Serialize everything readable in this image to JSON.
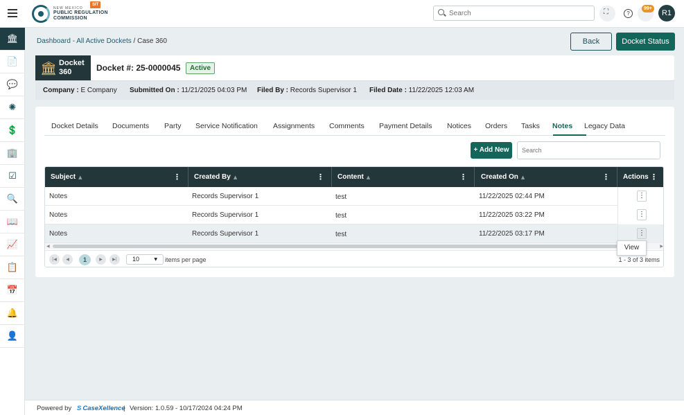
{
  "header": {
    "logo_top": "NEW MEXICO",
    "logo_mid": "PUBLIC REGULATION",
    "logo_bot": "COMMISSION",
    "env_badge": "SIT",
    "search_placeholder": "Search",
    "notif_count": "99+",
    "avatar_initials": "R1"
  },
  "sidebar": {
    "items": [
      {
        "name": "dockets",
        "icon": "🏛",
        "active": true
      },
      {
        "name": "documents",
        "icon": "📄"
      },
      {
        "name": "comments",
        "icon": "💬"
      },
      {
        "name": "processing",
        "icon": "✺"
      },
      {
        "name": "payments",
        "icon": "💲"
      },
      {
        "name": "companies",
        "icon": "🏢"
      },
      {
        "name": "tasks",
        "icon": "☑"
      },
      {
        "name": "search-records",
        "icon": "🔍"
      },
      {
        "name": "library",
        "icon": "📖"
      },
      {
        "name": "reports",
        "icon": "📈"
      },
      {
        "name": "schedule",
        "icon": "📋"
      },
      {
        "name": "calendar",
        "icon": "📅"
      },
      {
        "name": "alerts",
        "icon": "🔔"
      },
      {
        "name": "profile",
        "icon": "👤"
      }
    ]
  },
  "breadcrumb": {
    "dashboard": "Dashboard",
    "sep1": " - ",
    "active_dockets": "All Active Dockets",
    "sep2": " / ",
    "current": "Case 360"
  },
  "buttons": {
    "back": "Back",
    "docket_status": "Docket Status",
    "add_new": "+ Add New"
  },
  "docket": {
    "tag_line1": "Docket",
    "tag_line2": "360",
    "number": "Docket #: 25-0000045",
    "status": "Active"
  },
  "meta": {
    "company_label": "Company :",
    "company_value": " E Company",
    "submitted_label": "Submitted On :",
    "submitted_value": " 11/21/2025 04:03 PM",
    "filed_by_label": "Filed By :",
    "filed_by_value": " Records Supervisor 1",
    "filed_date_label": "Filed Date :",
    "filed_date_value": " 11/22/2025 12:03 AM"
  },
  "tabs": [
    "Docket Details",
    "Documents",
    "Party",
    "Service Notification",
    "Assignments",
    "Comments",
    "Payment Details",
    "Notices",
    "Orders",
    "Tasks",
    "Notes",
    "Legacy Data"
  ],
  "active_tab": "Notes",
  "notes_search_placeholder": "Search",
  "grid": {
    "columns": [
      "Subject",
      "Created By",
      "Content",
      "Created On",
      "Actions"
    ],
    "rows": [
      {
        "subject": "Notes",
        "created_by": "Records Supervisor 1",
        "content": "test",
        "created_on": "11/22/2025 02:44 PM"
      },
      {
        "subject": "Notes",
        "created_by": "Records Supervisor 1",
        "content": "test",
        "created_on": "11/22/2025 03:22 PM"
      },
      {
        "subject": "Notes",
        "created_by": "Records Supervisor 1",
        "content": "test",
        "created_on": "11/22/2025 03:17 PM"
      }
    ],
    "action_menu_item": "View"
  },
  "pager": {
    "current_page": "1",
    "page_size": "10",
    "items_per_page": "items per page",
    "info": "1 - 3 of 3 items"
  },
  "footer": {
    "powered_by": "Powered by",
    "brand": "CaseXellence",
    "separator": "|",
    "version": "Version: 1.0.59 - 10/17/2024 04:24 PM"
  }
}
